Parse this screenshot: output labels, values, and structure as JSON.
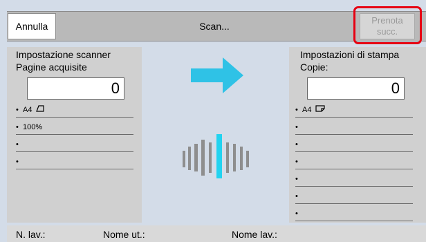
{
  "header": {
    "cancel_label": "Annulla",
    "title": "Scan...",
    "next_reserve_label_line1": "Prenota",
    "next_reserve_label_line2": "succ."
  },
  "scanner_panel": {
    "title_line1": "Impostazione scanner",
    "title_line2": "Pagine acquisite",
    "count": "0",
    "items": [
      "A4",
      "100%",
      "",
      ""
    ]
  },
  "print_panel": {
    "title_line1": "Impostazioni di stampa",
    "title_line2": "Copie:",
    "count": "0",
    "items": [
      "A4",
      "",
      "",
      "",
      "",
      "",
      ""
    ]
  },
  "status": {
    "job_no_label": "N. lav.:",
    "job_no_value": "",
    "user_name_label": "Nome ut.:",
    "user_name_value": "",
    "job_name_label": "Nome lav.:",
    "job_name_value": ""
  },
  "colors": {
    "arrow": "#2fc2e6",
    "highlight": "#e60012",
    "wave_active": "#22d3f0",
    "wave_idle": "#8e8e8e"
  },
  "icons": {
    "flow_arrow": "right-arrow-icon",
    "scan_progress": "scan-waveform-icon",
    "paper_scan": "paper-portrait-icon",
    "paper_print": "paper-landscape-icon"
  }
}
